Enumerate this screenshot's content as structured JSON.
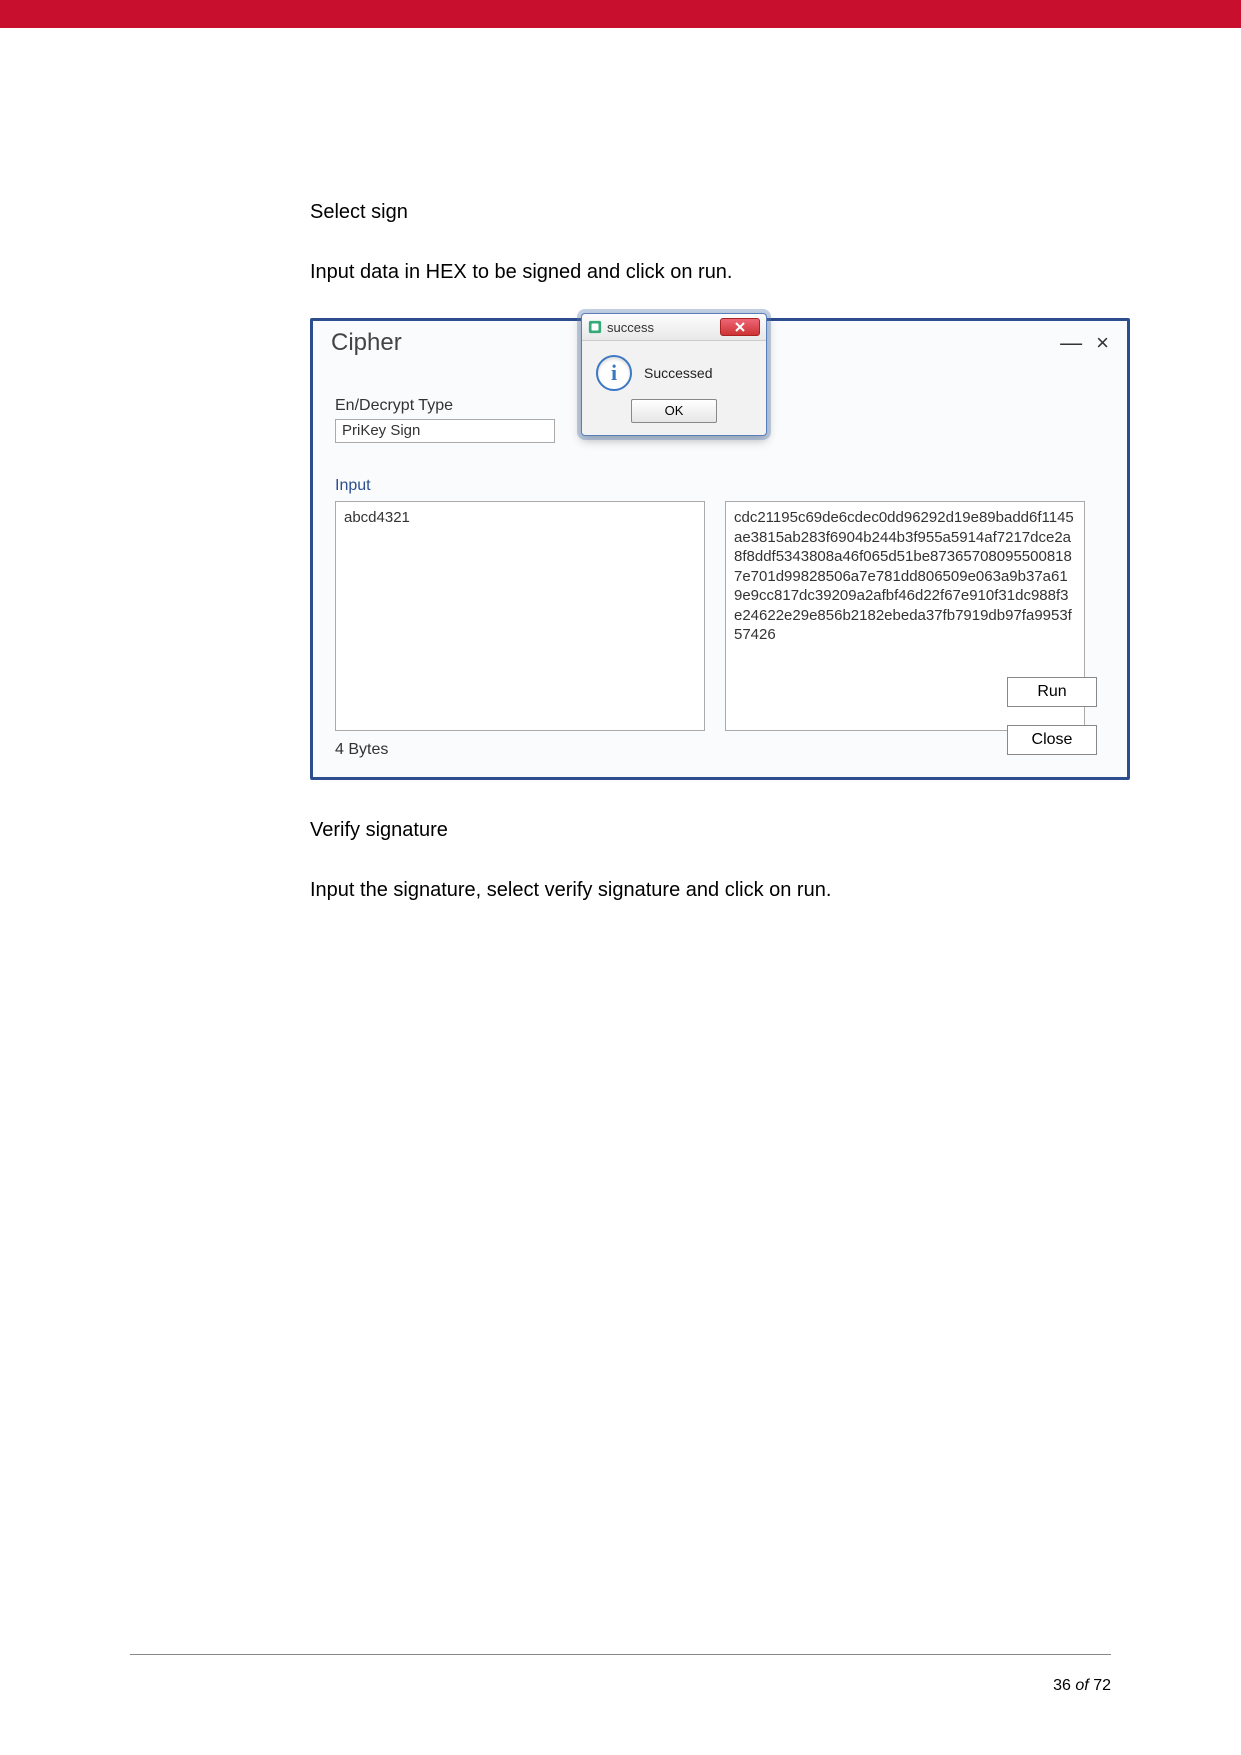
{
  "text": {
    "select_sign": "Select sign",
    "input_hex_instruction": "Input data in HEX to be signed and click on run.",
    "verify_sig_heading": "Verify signature",
    "verify_sig_instruction": "Input the signature, select verify signature and click on run."
  },
  "cipher_window": {
    "title": "Cipher",
    "minimize": "—",
    "close": "×",
    "en_decrypt_label": "En/Decrypt Type",
    "prikey_sign": "PriKey Sign",
    "input_label": "Input",
    "input_value": "abcd4321",
    "output_value": "cdc21195c69de6cdec0dd96292d19e89badd6f1145ae3815ab283f6904b244b3f955a5914af7217dce2a8f8ddf5343808a46f065d51be873657080955008187e701d99828506a7e781dd806509e063a9b37a619e9cc817dc39209a2afbf46d22f67e910f31dc988f3e24622e29e856b2182ebeda37fb7919db97fa9953f57426",
    "bytes_label": "4 Bytes",
    "run_btn": "Run",
    "close_btn": "Close"
  },
  "dialog": {
    "title": "success",
    "message": "Successed",
    "ok": "OK"
  },
  "footer": {
    "page": "36",
    "of": "of",
    "total": "72"
  }
}
